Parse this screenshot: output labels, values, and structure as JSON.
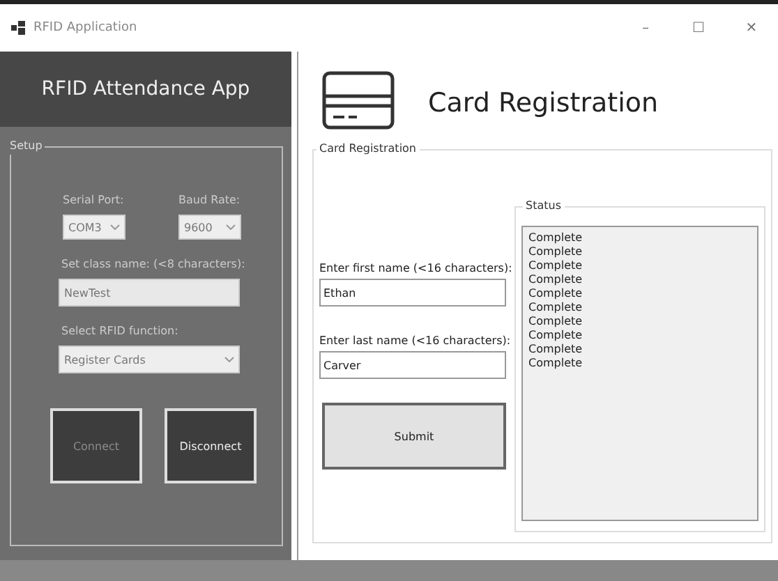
{
  "window": {
    "title": "RFID Application",
    "controls": [
      "–",
      "☐",
      "✕"
    ]
  },
  "sidebar": {
    "header": "RFID Attendance App",
    "group_title": "Setup",
    "serial_port": {
      "label": "Serial Port:",
      "value": "COM3"
    },
    "baud_rate": {
      "label": "Baud Rate:",
      "value": "9600"
    },
    "class_name": {
      "label": "Set class name: (<8 characters):",
      "value": "NewTest"
    },
    "rfid_function": {
      "label": "Select RFID function:",
      "value": "Register Cards"
    },
    "buttons": [
      {
        "label": "Connect",
        "disabled": true
      },
      {
        "label": "Disconnect",
        "disabled": false
      }
    ]
  },
  "main": {
    "title": "Card Registration",
    "group_title": "Card Registration",
    "first_name": {
      "label": "Enter first name (<16 characters):",
      "value": "Ethan"
    },
    "last_name": {
      "label": "Enter last name (<16 characters):",
      "value": "Carver"
    },
    "submit": "Submit",
    "status": {
      "title": "Status",
      "items": [
        "Complete",
        "Complete",
        "Complete",
        "Complete",
        "Complete",
        "Complete",
        "Complete",
        "Complete",
        "Complete",
        "Complete"
      ]
    }
  }
}
